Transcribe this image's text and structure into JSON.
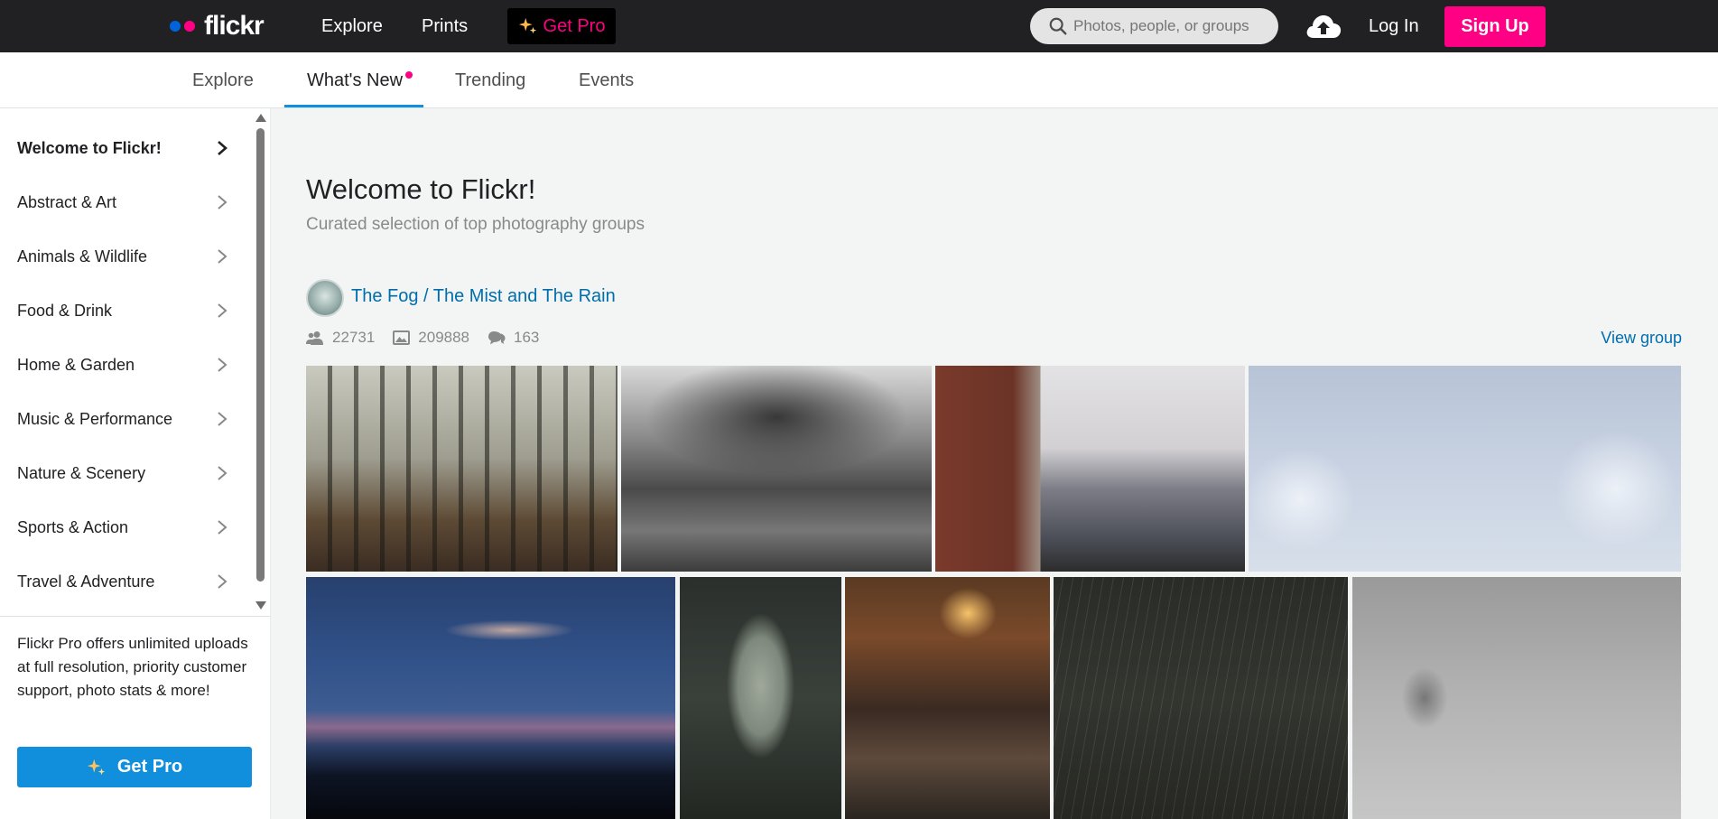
{
  "header": {
    "logo_text": "flickr",
    "logo_colors": [
      "#0063dc",
      "#ff0084"
    ],
    "nav": [
      "Explore",
      "Prints"
    ],
    "get_pro_label": "Get Pro",
    "search_placeholder": "Photos, people, or groups",
    "login_label": "Log In",
    "signup_label": "Sign Up"
  },
  "subnav": {
    "tabs": [
      "Explore",
      "What's New",
      "Trending",
      "Events"
    ],
    "active_tab": "What's New"
  },
  "sidebar": {
    "categories": [
      "Welcome to Flickr!",
      "Abstract & Art",
      "Animals & Wildlife",
      "Food & Drink",
      "Home & Garden",
      "Music & Performance",
      "Nature & Scenery",
      "Sports & Action",
      "Travel & Adventure"
    ],
    "pro_text": "Flickr Pro offers unlimited uploads at full resolution, priority customer support, photo stats & more!",
    "pro_button": "Get Pro"
  },
  "main": {
    "title": "Welcome to Flickr!",
    "subtitle": "Curated selection of top photography groups",
    "group": {
      "name": "The Fog / The Mist and The Rain",
      "members": "22731",
      "photos": "209888",
      "discussions": "163",
      "view_label": "View group"
    }
  },
  "colors": {
    "brand_pink": "#ff0084",
    "brand_blue": "#0063dc",
    "link_blue": "#006dac",
    "accent_blue": "#128fdc",
    "topbar_bg": "#212124"
  }
}
